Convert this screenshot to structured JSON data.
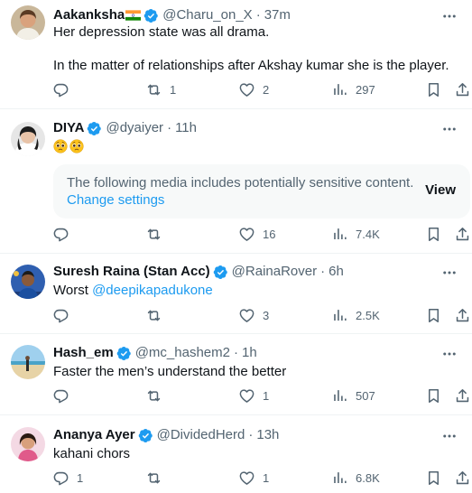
{
  "colors": {
    "accent": "#1d9bf0",
    "text": "#0f1419",
    "muted": "#536471",
    "divider": "#eff3f4"
  },
  "tweets": [
    {
      "name": "Aakanksha",
      "handle": "@Charu_on_X",
      "time": "37m",
      "flag": "india-flag-emoji",
      "lines": [
        "Her depression state was all drama.",
        "In the matter of relationships after Akshay kumar she is the player."
      ],
      "replies": "",
      "retweets": "1",
      "likes": "2",
      "views": "297"
    },
    {
      "name": "DIYA",
      "handle": "@dyaiyer",
      "time": "11h",
      "emojis": [
        "pleading-face-emoji",
        "pleading-face-emoji"
      ],
      "sensitive": {
        "message": "The following media includes potentially sensitive content.",
        "link": "Change settings",
        "view": "View"
      },
      "replies": "",
      "retweets": "",
      "likes": "16",
      "views": "7.4K"
    },
    {
      "name": "Suresh Raina (Stan Acc)",
      "handle": "@RainaRover",
      "time": "6h",
      "text_prefix": "Worst ",
      "mention": "@deepikapadukone",
      "replies": "",
      "retweets": "",
      "likes": "3",
      "views": "2.5K"
    },
    {
      "name": "Hash_em",
      "handle": "@mc_hashem2",
      "time": "1h",
      "text": "Faster the men’s understand the better",
      "replies": "",
      "retweets": "",
      "likes": "1",
      "views": "507"
    },
    {
      "name": "Ananya Ayer",
      "handle": "@DividedHerd",
      "time": "13h",
      "text": "kahani chors",
      "replies": "1",
      "retweets": "",
      "likes": "1",
      "views": "6.8K"
    }
  ]
}
